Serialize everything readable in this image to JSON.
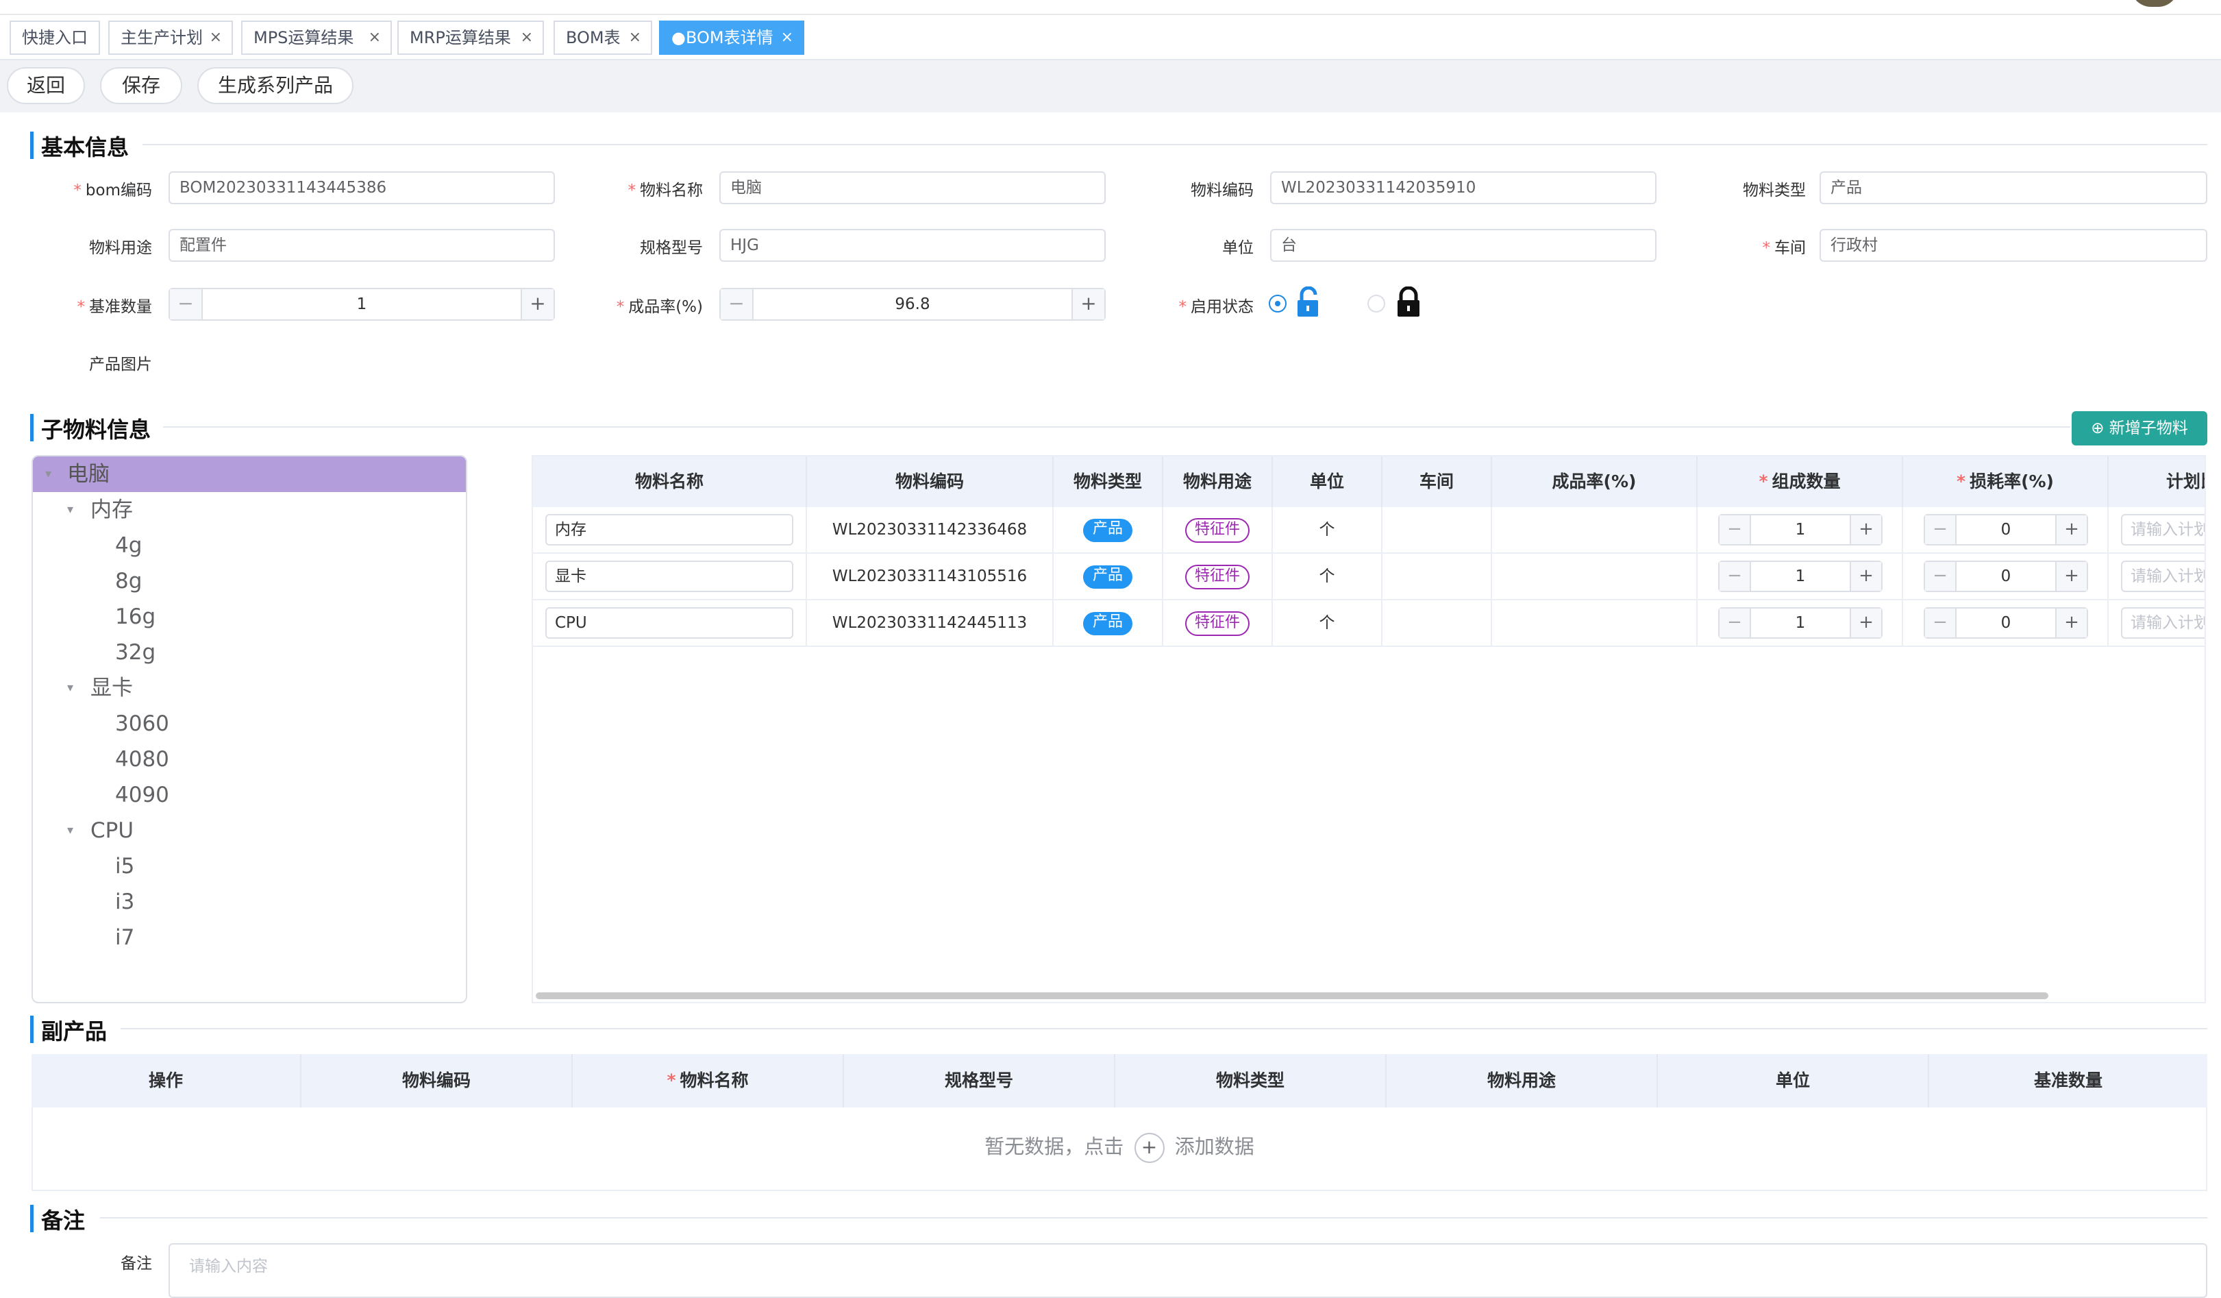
{
  "tabs": [
    {
      "label": "快捷入口",
      "closable": false
    },
    {
      "label": "主生产计划",
      "closable": true
    },
    {
      "label": "MPS运算结果",
      "closable": true
    },
    {
      "label": "MRP运算结果",
      "closable": true
    },
    {
      "label": "BOM表",
      "closable": true
    },
    {
      "label": "●BOM表详情",
      "closable": true,
      "active": true
    }
  ],
  "tab_close_glyph": "×",
  "toolbar": {
    "back": "返回",
    "save": "保存",
    "generate": "生成系列产品"
  },
  "basic": {
    "title": "基本信息",
    "required_mark": "*",
    "bom_code_label": "bom编码",
    "bom_code": "BOM20230331143445386",
    "material_name_label": "物料名称",
    "material_name": "电脑",
    "material_code_label": "物料编码",
    "material_code": "WL20230331142035910",
    "material_type_label": "物料类型",
    "material_type": "产品",
    "usage_label": "物料用途",
    "usage": "配置件",
    "spec_label": "规格型号",
    "spec": "HJG",
    "unit_label": "单位",
    "unit": "台",
    "workshop_label": "车间",
    "workshop": "行政村",
    "base_qty_label": "基准数量",
    "base_qty": "1",
    "yield_label": "成品率(%)",
    "yield": "96.8",
    "status_label": "启用状态",
    "status_enabled": true,
    "image_label": "产品图片"
  },
  "stepper": {
    "minus": "−",
    "plus": "+"
  },
  "sub": {
    "title": "子物料信息",
    "add_button": "新增子物料",
    "add_icon": "⊕",
    "tree": [
      {
        "label": "电脑",
        "level": 0,
        "expanded": true,
        "selected": true
      },
      {
        "label": "内存",
        "level": 1,
        "expanded": true
      },
      {
        "label": "4g",
        "level": 2
      },
      {
        "label": "8g",
        "level": 2
      },
      {
        "label": "16g",
        "level": 2
      },
      {
        "label": "32g",
        "level": 2
      },
      {
        "label": "显卡",
        "level": 1,
        "expanded": true
      },
      {
        "label": "3060",
        "level": 2
      },
      {
        "label": "4080",
        "level": 2
      },
      {
        "label": "4090",
        "level": 2
      },
      {
        "label": "CPU",
        "level": 1,
        "expanded": true
      },
      {
        "label": "i5",
        "level": 2
      },
      {
        "label": "i3",
        "level": 2
      },
      {
        "label": "i7",
        "level": 2
      }
    ],
    "columns": [
      "物料名称",
      "物料编码",
      "物料类型",
      "物料用途",
      "单位",
      "车间",
      "成品率(%)",
      "组成数量",
      "损耗率(%)",
      "计划比"
    ],
    "required_columns": [
      7,
      8
    ],
    "rows": [
      {
        "name": "内存",
        "code": "WL20230331142336468",
        "type": "产品",
        "usage": "特征件",
        "unit": "个",
        "workshop": "",
        "yield": "",
        "qty": "1",
        "loss": "0",
        "plan_placeholder": "请输入计划比"
      },
      {
        "name": "显卡",
        "code": "WL20230331143105516",
        "type": "产品",
        "usage": "特征件",
        "unit": "个",
        "workshop": "",
        "yield": "",
        "qty": "1",
        "loss": "0",
        "plan_placeholder": "请输入计划比"
      },
      {
        "name": "CPU",
        "code": "WL20230331142445113",
        "type": "产品",
        "usage": "特征件",
        "unit": "个",
        "workshop": "",
        "yield": "",
        "qty": "1",
        "loss": "0",
        "plan_placeholder": "请输入计划比"
      }
    ]
  },
  "byproduct": {
    "title": "副产品",
    "columns": [
      "操作",
      "物料编码",
      "物料名称",
      "规格型号",
      "物料类型",
      "物料用途",
      "单位",
      "基准数量"
    ],
    "required_columns": [
      2
    ],
    "empty_text_before": "暂无数据，点击",
    "empty_icon": "+",
    "empty_text_after": "添加数据"
  },
  "remark": {
    "title": "备注",
    "label": "备注",
    "placeholder": "请输入内容"
  },
  "colors": {
    "accent": "#1e88e5",
    "active_tab": "#42a5f5",
    "add_button": "#26a69a",
    "tag_blue": "#2196f3",
    "tag_purple": "#9c27b0",
    "tree_selected": "#b39ddb",
    "header_bg": "#eef3fb"
  }
}
